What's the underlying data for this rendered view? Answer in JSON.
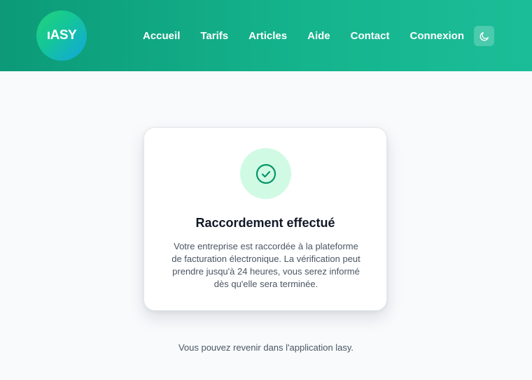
{
  "header": {
    "logo_text": "ıASY",
    "nav": [
      {
        "label": "Accueil"
      },
      {
        "label": "Tarifs"
      },
      {
        "label": "Articles"
      },
      {
        "label": "Aide"
      },
      {
        "label": "Contact"
      },
      {
        "label": "Connexion"
      }
    ],
    "theme_toggle_icon": "moon-icon"
  },
  "card": {
    "icon": "check-circle-icon",
    "title": "Raccordement effectué",
    "body_lines": [
      "Votre entreprise est raccordée à la plateforme",
      "de facturation électronique. La vérification peut",
      "prendre jusqu'à 24 heures, vous serez informé",
      "dès qu'elle sera terminée."
    ]
  },
  "footer": {
    "note": "Vous pouvez revenir dans l'application lasy."
  },
  "colors": {
    "header_start": "#0c9a78",
    "header_end": "#1bbd98",
    "success_bg": "#d1fae5",
    "success_icon": "#059669",
    "text_primary": "#111827",
    "text_secondary": "#4b5563"
  }
}
